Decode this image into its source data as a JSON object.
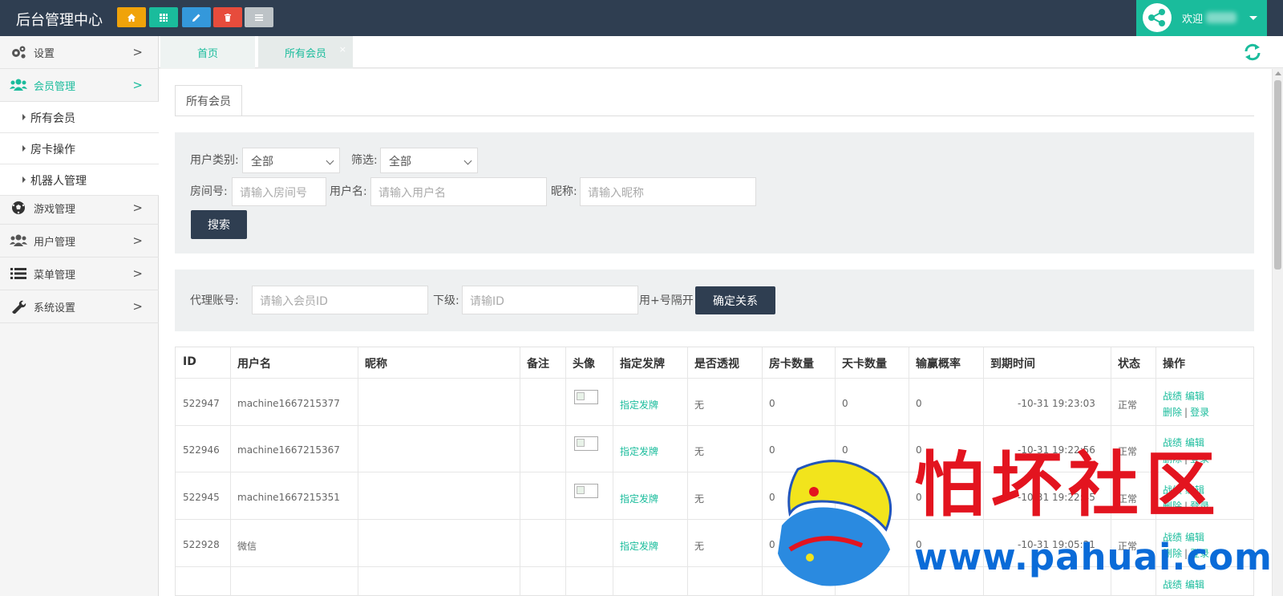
{
  "app": {
    "title": "后台管理中心",
    "welcome": "欢迎",
    "quick_buttons": [
      {
        "name": "home",
        "color": "#f0a30a"
      },
      {
        "name": "grid",
        "color": "#1abc9c"
      },
      {
        "name": "pencil",
        "color": "#3498db"
      },
      {
        "name": "trash",
        "color": "#e74c3c"
      },
      {
        "name": "list",
        "color": "#bdc3c7"
      }
    ]
  },
  "sidebar": {
    "items": [
      {
        "label": "设置",
        "icon": "gears-icon"
      },
      {
        "label": "会员管理",
        "icon": "users-icon",
        "active": true
      },
      {
        "label": "游戏管理",
        "icon": "soccer-ball-icon"
      },
      {
        "label": "用户管理",
        "icon": "users-icon"
      },
      {
        "label": "菜单管理",
        "icon": "list-icon"
      },
      {
        "label": "系统设置",
        "icon": "wrench-icon"
      }
    ],
    "subitems": [
      "所有会员",
      "房卡操作",
      "机器人管理"
    ],
    "chevron": ">"
  },
  "tabs": [
    {
      "label": "首页"
    },
    {
      "label": "所有会员",
      "close": "×"
    }
  ],
  "page": {
    "tab": "所有会员"
  },
  "filters": {
    "user_type_label": "用户类别:",
    "user_type_value": "全部",
    "filter_label": "筛选:",
    "filter_value": "全部",
    "room_label": "房间号:",
    "room_placeholder": "请输入房间号",
    "username_label": "用户名:",
    "username_placeholder": "请输入用户名",
    "nickname_label": "昵称:",
    "nickname_placeholder": "请输入昵称",
    "search_button": "搜索"
  },
  "agent": {
    "account_label": "代理账号:",
    "account_placeholder": "请输入会员ID",
    "sub_label": "下级:",
    "sub_placeholder": "请输ID",
    "hint": "用+号隔开",
    "confirm_button": "确定关系"
  },
  "table": {
    "headers": [
      "ID",
      "用户名",
      "昵称",
      "备注",
      "头像",
      "指定发牌",
      "是否透视",
      "房卡数量",
      "天卡数量",
      "输赢概率",
      "到期时间",
      "状态",
      "操作"
    ],
    "rows": [
      {
        "id": "522947",
        "username": "machine1667215377",
        "has_avatar": true,
        "deal": "指定发牌",
        "perspective": "无",
        "room_cards": "0",
        "day_cards": "0",
        "win_rate": "0",
        "expire": "-10-31 19:23:03",
        "status": "正常",
        "actions": [
          "战绩",
          "编辑",
          "删除",
          "|",
          "登录"
        ]
      },
      {
        "id": "522946",
        "username": "machine1667215367",
        "has_avatar": true,
        "deal": "指定发牌",
        "perspective": "无",
        "room_cards": "0",
        "day_cards": "0",
        "win_rate": "0",
        "expire": "-10-31 19:22:56",
        "status": "正常",
        "actions": [
          "战绩",
          "编辑",
          "删除",
          "|",
          "登录"
        ]
      },
      {
        "id": "522945",
        "username": "machine1667215351",
        "has_avatar": true,
        "deal": "指定发牌",
        "perspective": "无",
        "room_cards": "0",
        "day_cards": "0",
        "win_rate": "0",
        "expire": "-10-31 19:22:45",
        "status": "正常",
        "actions": [
          "战绩",
          "编辑",
          "删除",
          "|",
          "登录"
        ]
      },
      {
        "id": "522928",
        "username": "微信",
        "has_avatar": false,
        "deal": "指定发牌",
        "perspective": "无",
        "room_cards": "0",
        "day_cards": "0",
        "win_rate": "0",
        "expire": "-10-31 19:05:31",
        "status": "正常",
        "actions": [
          "战绩",
          "编辑",
          "删除",
          "|",
          "登录"
        ]
      },
      {
        "id": "",
        "username": "",
        "has_avatar": false,
        "deal": "",
        "perspective": "",
        "room_cards": "",
        "day_cards": "",
        "win_rate": "",
        "expire": "",
        "status": "",
        "actions": [
          "战绩",
          "编辑"
        ]
      }
    ]
  },
  "watermark": {
    "text": "怕坏社区",
    "url": "www.pahuai.com"
  }
}
